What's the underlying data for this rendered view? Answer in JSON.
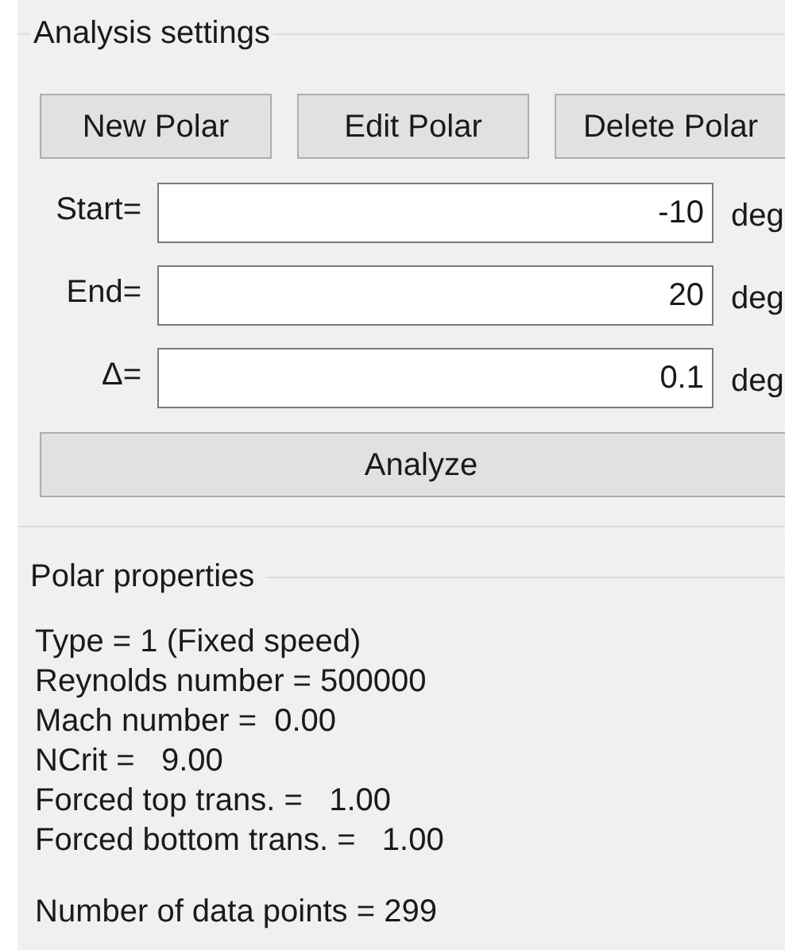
{
  "analysis_settings": {
    "title": "Analysis settings",
    "buttons": [
      "New Polar",
      "Edit Polar",
      "Delete Polar"
    ],
    "fields": [
      {
        "label": "Start=",
        "value": "-10",
        "unit": "deg"
      },
      {
        "label": "End=",
        "value": "20",
        "unit": "deg"
      },
      {
        "label": "Δ=",
        "value": "0.1",
        "unit": "deg"
      }
    ],
    "analyze_button": "Analyze"
  },
  "polar_properties": {
    "title": "Polar properties",
    "lines": [
      "Type = 1 (Fixed speed)",
      "Reynolds number = 500000",
      "Mach number =  0.00",
      "NCrit =   9.00",
      "Forced top trans. =   1.00",
      "Forced bottom trans. =   1.00"
    ],
    "footer_lines": [
      "Number of data points = 299"
    ]
  }
}
